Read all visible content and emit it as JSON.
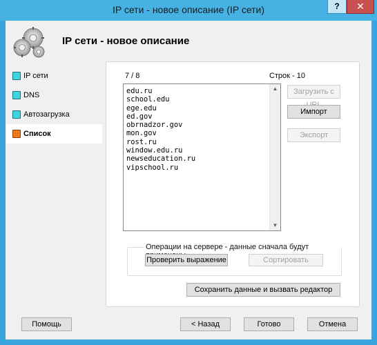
{
  "window": {
    "title": "IP сети - новое описание (IP сети)",
    "help_label": "?",
    "close_label": "✕"
  },
  "header": {
    "title": "IP сети - новое описание"
  },
  "nav": {
    "items": [
      {
        "label": "IP сети",
        "active": false
      },
      {
        "label": "DNS",
        "active": false
      },
      {
        "label": "Автозагрузка",
        "active": false
      },
      {
        "label": "Список",
        "active": true
      }
    ]
  },
  "panel": {
    "count": "7 / 8",
    "rows": "Строк - 10",
    "list_text": "edu.ru\nschool.edu\nege.edu\ned.gov\nobrnadzor.gov\nmon.gov\nrost.ru\nwindow.edu.ru\nnewseducation.ru\nvipschool.ru",
    "load_url": "Загрузить с URL",
    "import": "Импорт",
    "export": "Экспорт",
    "server_ops_legend": "Операции на сервере - данные сначала будут применены",
    "check_expr": "Проверить выражение",
    "sort": "Сортировать",
    "save_and_edit": "Сохранить данные и вызвать редактор"
  },
  "footer": {
    "help": "Помощь",
    "back": "< Назад",
    "done": "Готово",
    "cancel": "Отмена"
  },
  "colors": {
    "titlebar": "#46b1e3",
    "frame": "#3aa5dc",
    "nav_square": "#3fd6e3",
    "nav_active_square": "#f07a1a",
    "close_button": "#c75050"
  },
  "icons": {
    "header": "gears-icon",
    "scroll_up": "chevron-up-icon",
    "scroll_down": "chevron-down-icon"
  }
}
